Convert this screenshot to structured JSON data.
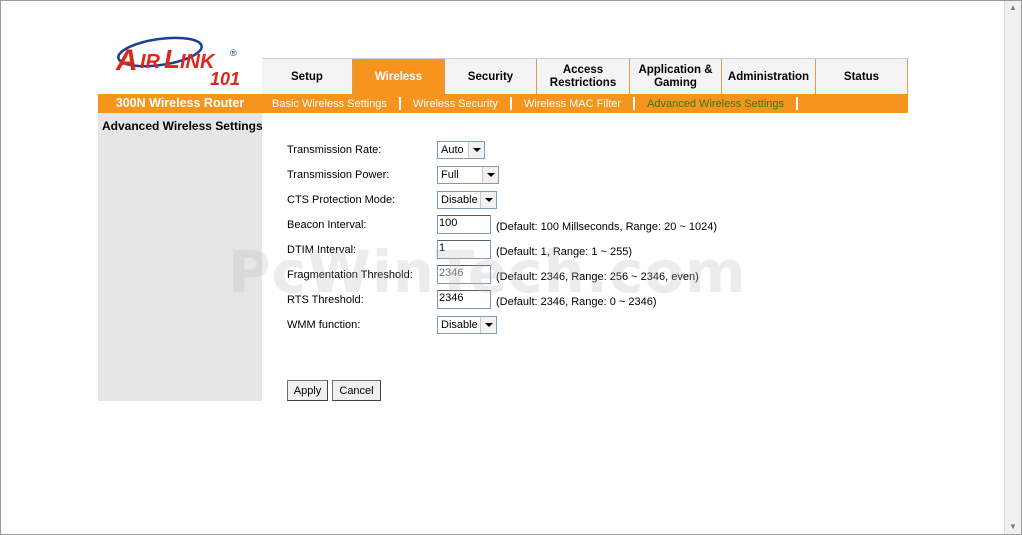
{
  "brand": {
    "logo_line1": "AIRLINK",
    "logo_line2": "101",
    "registered": "®",
    "color": "#e0261b",
    "accent": "#1c3f94"
  },
  "tabs": [
    {
      "label": "Setup",
      "active": false
    },
    {
      "label": "Wireless",
      "active": true
    },
    {
      "label": "Security",
      "active": false
    },
    {
      "label": "Access Restrictions",
      "active": false
    },
    {
      "label": "Application & Gaming",
      "active": false
    },
    {
      "label": "Administration",
      "active": false
    },
    {
      "label": "Status",
      "active": false
    }
  ],
  "router_title": "300N Wireless Router",
  "subnav": [
    {
      "label": "Basic Wireless Settings",
      "active": false
    },
    {
      "label": "Wireless Security",
      "active": false
    },
    {
      "label": "Wireless MAC Filter",
      "active": false
    },
    {
      "label": "Advanced Wireless Settings",
      "active": true
    }
  ],
  "side_title": "Advanced Wireless Settings",
  "form": {
    "transmission_rate": {
      "label": "Transmission Rate:",
      "value": "Auto"
    },
    "transmission_power": {
      "label": "Transmission Power:",
      "value": "Full"
    },
    "cts_protection": {
      "label": "CTS Protection Mode:",
      "value": "Disable"
    },
    "beacon_interval": {
      "label": "Beacon Interval:",
      "value": "100",
      "hint": "(Default: 100 Millseconds, Range: 20 ~ 1024)"
    },
    "dtim_interval": {
      "label": "DTIM Interval:",
      "value": "1",
      "hint": "(Default: 1, Range: 1 ~ 255)"
    },
    "fragmentation_threshold": {
      "label": "Fragmentation Threshold:",
      "value": "2346",
      "hint": "(Default: 2346, Range: 256 ~ 2346, even)"
    },
    "rts_threshold": {
      "label": "RTS Threshold:",
      "value": "2346",
      "hint": "(Default: 2346, Range: 0 ~ 2346)"
    },
    "wmm_function": {
      "label": "WMM function:",
      "value": "Disable"
    }
  },
  "buttons": {
    "apply": "Apply",
    "cancel": "Cancel"
  },
  "watermark": "PcWinTech.com",
  "colors": {
    "orange": "#f7941d",
    "active_subnav": "#2e7d0f",
    "side_panel": "#e6e6e6"
  }
}
